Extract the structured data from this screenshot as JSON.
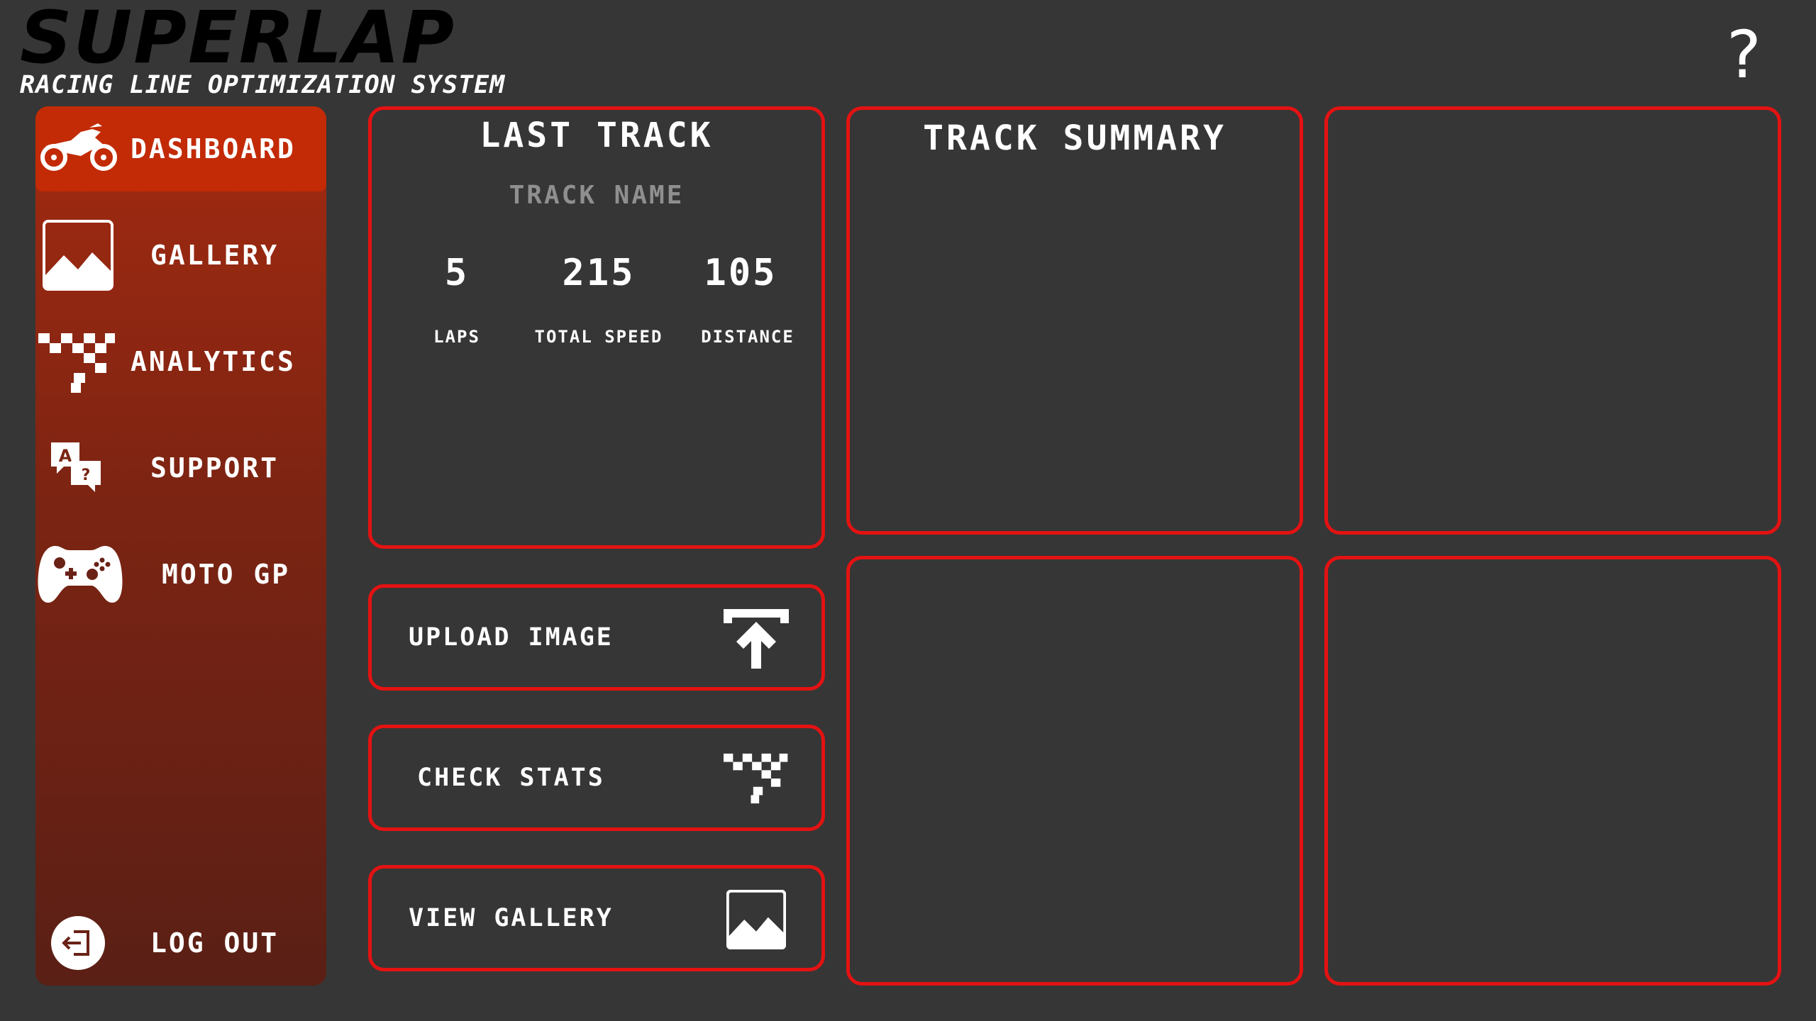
{
  "header": {
    "title": "SUPERLAP",
    "subtitle": "RACING LINE OPTIMIZATION SYSTEM",
    "help_label": "?"
  },
  "sidebar": {
    "items": [
      {
        "label": "DASHBOARD",
        "icon": "motorcycle-icon",
        "active": true
      },
      {
        "label": "GALLERY",
        "icon": "image-icon",
        "active": false
      },
      {
        "label": "ANALYTICS",
        "icon": "checkered-flag-icon",
        "active": false
      },
      {
        "label": "SUPPORT",
        "icon": "translate-help-icon",
        "active": false
      },
      {
        "label": "MOTO GP",
        "icon": "gamepad-icon",
        "active": false
      }
    ],
    "logout_label": "LOG OUT"
  },
  "last_track": {
    "title": "LAST TRACK",
    "track_name": "TRACK NAME",
    "stats": [
      {
        "value": "5",
        "label": "LAPS"
      },
      {
        "value": "215",
        "label": "TOTAL SPEED"
      },
      {
        "value": "105",
        "label": "DISTANCE"
      }
    ]
  },
  "actions": {
    "upload_label": "UPLOAD IMAGE",
    "stats_label": "CHECK STATS",
    "gallery_label": "VIEW GALLERY"
  },
  "track_summary": {
    "title": "TRACK SUMMARY"
  },
  "colors": {
    "background": "#363636",
    "accent": "#e41212",
    "active_nav": "#c22b06",
    "sidebar_top": "#a42a10",
    "sidebar_bottom": "#5a1f15"
  }
}
